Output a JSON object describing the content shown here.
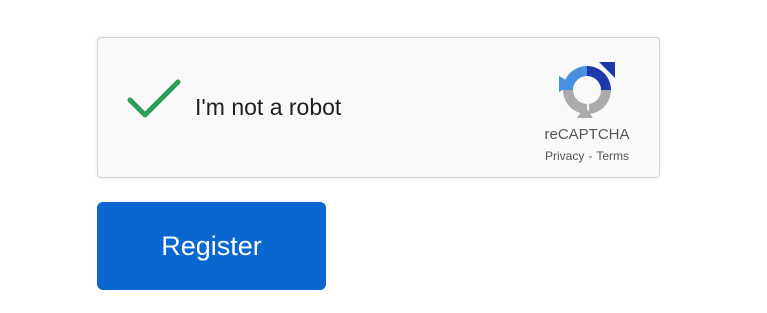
{
  "captcha": {
    "label": "I'm not a robot",
    "checked": true,
    "brand": "reCAPTCHA",
    "privacy_link": "Privacy",
    "separator": "-",
    "terms_link": "Terms",
    "check_icon": "checkmark-icon",
    "logo_icon": "recaptcha-logo-icon",
    "colors": {
      "checkmark": "#2e9e5b",
      "logo_blue": "#1c3aa9",
      "logo_light_blue": "#4a90e2",
      "logo_gray": "#ababab"
    }
  },
  "form": {
    "register_label": "Register",
    "register_color": "#0a66d1"
  }
}
